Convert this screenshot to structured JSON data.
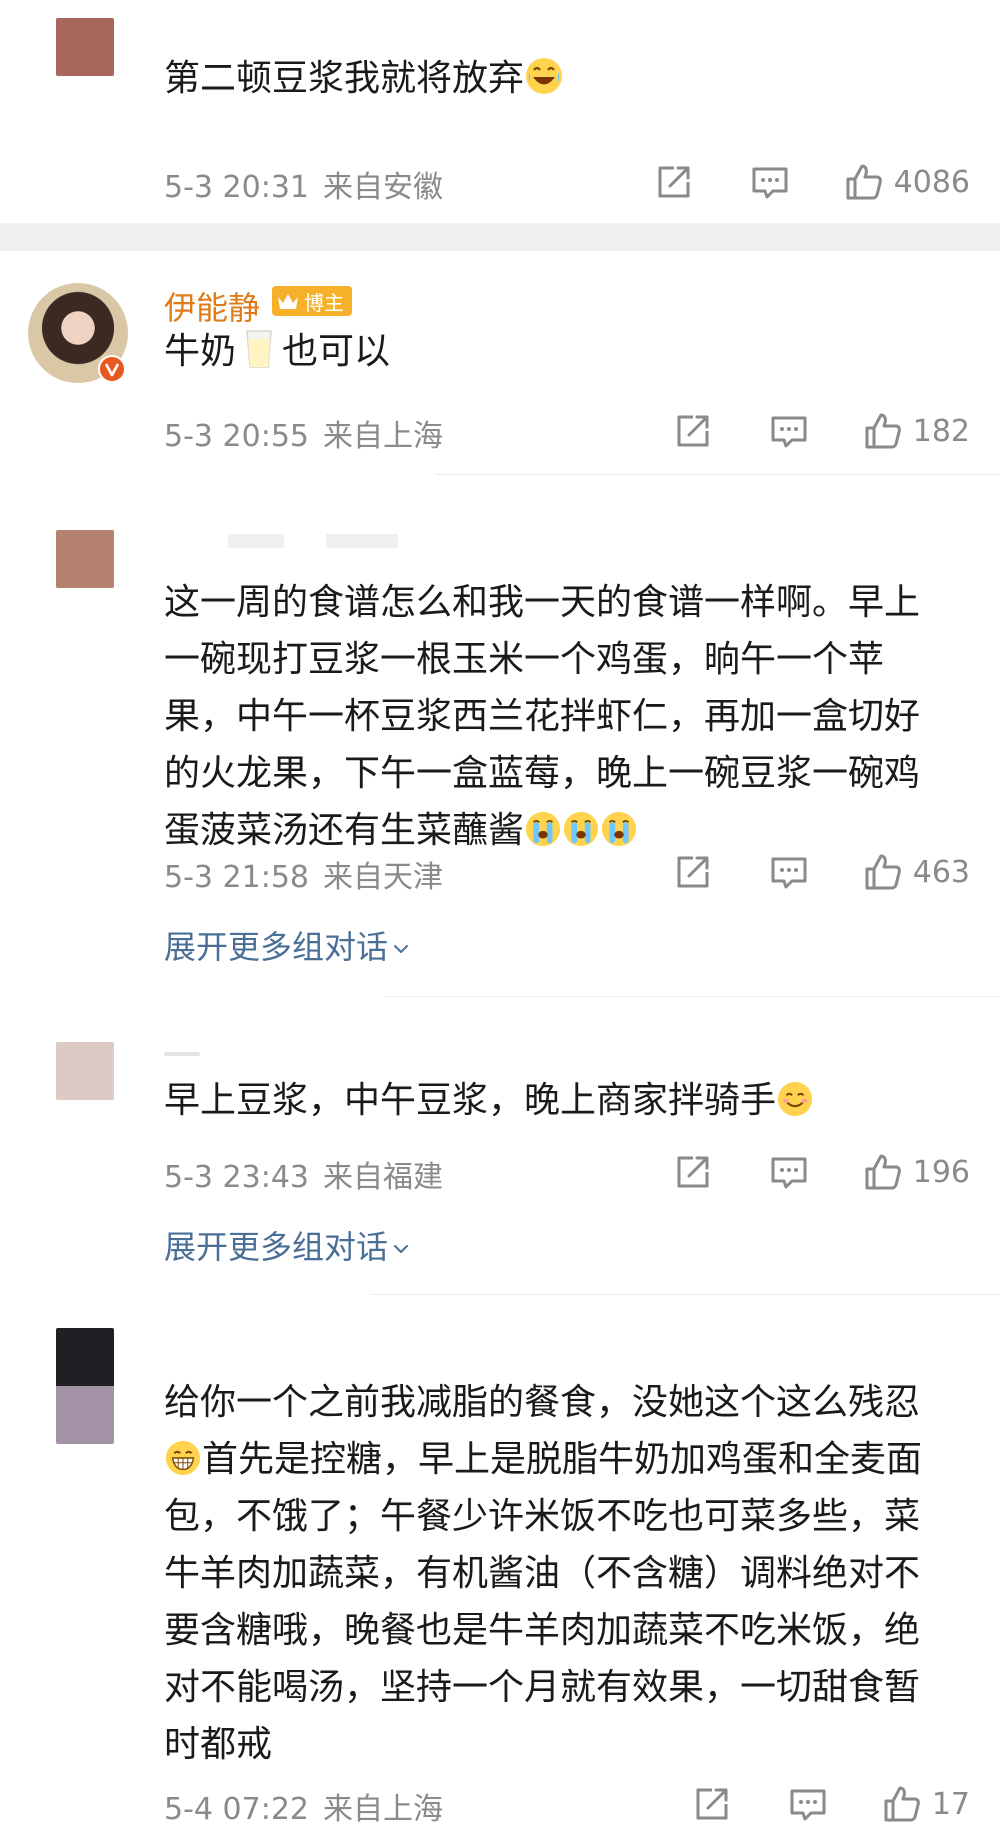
{
  "colors": {
    "username": "#e07b18",
    "link": "#4a6f96",
    "meta": "#8a8a8a",
    "text": "#1a1a1a",
    "badge": "#f7b02a",
    "verified": "#e8571f"
  },
  "comments": [
    {
      "text": "第二顿豆浆我就将放弃",
      "emoji_after": "laughing-tears-emoji",
      "date": "5-3 20:31",
      "location": "来自安徽",
      "likes": "4086"
    },
    {
      "username": "伊能静",
      "badge": "博主",
      "text_before": "牛奶",
      "text_after": "也可以",
      "emoji_mid": "milk-glass-emoji",
      "date": "5-3 20:55",
      "location": "来自上海",
      "likes": "182"
    },
    {
      "text_lines": [
        "这一周的食谱怎么和我一天的食谱一样啊。早上",
        "一碗现打豆浆一根玉米一个鸡蛋，晌午一个苹",
        "果，中午一杯豆浆西兰花拌虾仁，再加一盒切好",
        "的火龙果，下午一盒蓝莓，晚上一碗豆浆一碗鸡",
        "蛋菠菜汤还有生菜蘸酱"
      ],
      "emoji_after": "crying-emoji",
      "date": "5-3 21:58",
      "location": "来自天津",
      "likes": "463",
      "expand": "展开更多组对话"
    },
    {
      "text": "早上豆浆，中午豆浆，晚上商家拌骑手",
      "emoji_after": "smile-emoji",
      "date": "5-3 23:43",
      "location": "来自福建",
      "likes": "196",
      "expand": "展开更多组对话"
    },
    {
      "line1": "给你一个之前我减脂的餐食，没她这个这么残忍",
      "emoji_line2": "grin-emoji",
      "line2": "首先是控糖，早上是脱脂牛奶加鸡蛋和全麦面",
      "text_lines": [
        "包，不饿了；午餐少许米饭不吃也可菜多些，菜",
        "牛羊肉加蔬菜，有机酱油（不含糖）调料绝对不",
        "要含糖哦，晚餐也是牛羊肉加蔬菜不吃米饭，绝",
        "对不能喝汤，坚持一个月就有效果，一切甜食暂",
        "时都戒"
      ],
      "date": "5-4 07:22",
      "location": "来自上海",
      "likes": "17"
    }
  ]
}
